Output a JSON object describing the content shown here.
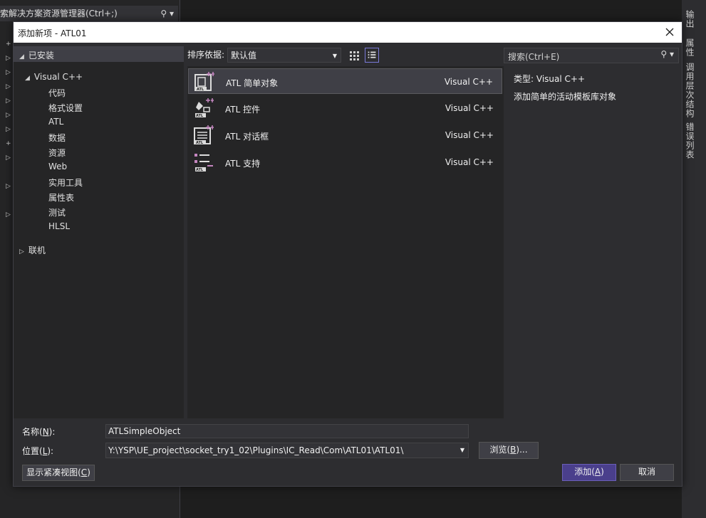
{
  "background": {
    "search_text": "索解决方案资源管理器(Ctrl+;)",
    "right_tabs": [
      "输出",
      "属性",
      "调用层次结构",
      "错误列表"
    ]
  },
  "dialog": {
    "title": "添加新项 - ATL01",
    "tree": {
      "installed": "已安装",
      "visual_cpp": "Visual C++",
      "children": [
        "代码",
        "格式设置",
        "ATL",
        "数据",
        "资源",
        "Web",
        "实用工具",
        "属性表",
        "测试",
        "HLSL"
      ],
      "online": "联机"
    },
    "sort_label": "排序依据:",
    "sort_value": "默认值",
    "templates": [
      {
        "name": "ATL 简单对象",
        "lang": "Visual C++",
        "icon": "atl-simple-object-icon"
      },
      {
        "name": "ATL 控件",
        "lang": "Visual C++",
        "icon": "atl-control-icon"
      },
      {
        "name": "ATL 对话框",
        "lang": "Visual C++",
        "icon": "atl-dialog-icon"
      },
      {
        "name": "ATL 支持",
        "lang": "Visual C++",
        "icon": "atl-support-icon"
      }
    ],
    "search_placeholder": "搜索(Ctrl+E)",
    "details": {
      "type_label": "类型:",
      "type_value": "Visual C++",
      "description": "添加简单的活动模板库对象"
    },
    "name_label_pre": "名称(",
    "name_label_key": "N",
    "name_label_post": "):",
    "name_value": "ATLSimpleObject",
    "location_label_pre": "位置(",
    "location_label_key": "L",
    "location_label_post": "):",
    "location_value": "Y:\\YSP\\UE_project\\socket_try1_02\\Plugins\\IC_Read\\Com\\ATL01\\ATL01\\",
    "browse_pre": "浏览(",
    "browse_key": "B",
    "browse_post": ")...",
    "compact_pre": "显示紧凑视图(",
    "compact_key": "C",
    "compact_post": ")",
    "add_pre": "添加(",
    "add_key": "A",
    "add_post": ")",
    "cancel": "取消"
  },
  "colors": {
    "accent": "#4a3f8c",
    "icon_pink": "#c586c0",
    "bg": "#1e1e1e",
    "panel": "#252526"
  }
}
